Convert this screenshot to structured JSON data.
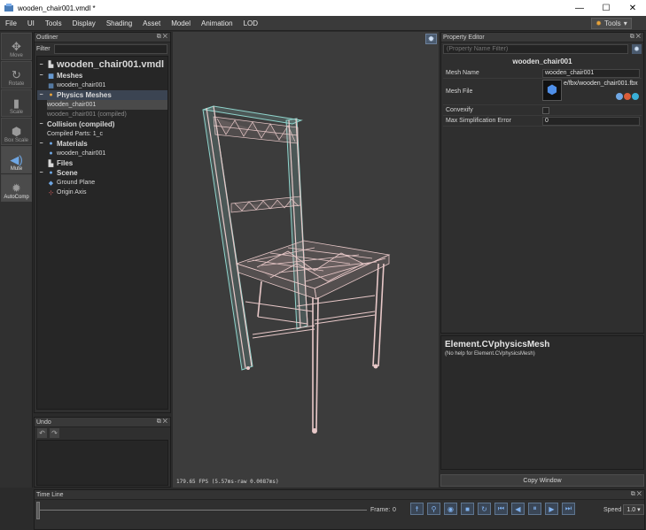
{
  "window": {
    "title": "wooden_chair001.vmdl *",
    "minimize": "—",
    "maximize": "☐",
    "close": "✕"
  },
  "menu": {
    "items": [
      "File",
      "UI",
      "Tools",
      "Display",
      "Shading",
      "Asset",
      "Model",
      "Animation",
      "LOD"
    ],
    "tools_button": "Tools"
  },
  "left_tools": [
    {
      "label": "Move",
      "icon": "move-icon"
    },
    {
      "label": "Rotate",
      "icon": "rotate-icon"
    },
    {
      "label": "Scale",
      "icon": "scale-icon"
    },
    {
      "label": "Box Scale",
      "icon": "box-scale-icon"
    },
    {
      "label": "Mute",
      "icon": "mute-icon"
    },
    {
      "label": "AutoComp",
      "icon": "autocomp-icon"
    }
  ],
  "outliner": {
    "title": "Outliner",
    "filter_label": "Filter",
    "filter_value": "",
    "root": "wooden_chair001.vmdl",
    "meshes_header": "Meshes",
    "mesh_item": "wooden_chair001",
    "physics_header": "Physics Meshes",
    "physics_item": "wooden_chair001",
    "physics_compiled": "wooden_chair001 (compiled)",
    "collision_header": "Collision (compiled)",
    "compiled_parts": "Compiled Parts: 1_c",
    "materials_header": "Materials",
    "material_item": "wooden_chair001",
    "files_header": "Files",
    "scene_header": "Scene",
    "ground_plane": "Ground Plane",
    "origin_axis": "Origin Axis"
  },
  "undo": {
    "title": "Undo"
  },
  "viewport": {
    "fps_readout": "179.65 FPS (5.57ms-raw 0.0087ms)"
  },
  "properties": {
    "title": "Property Editor",
    "filter_placeholder": "(Property Name Filter)",
    "object_name": "wooden_chair001",
    "rows": {
      "mesh_name_label": "Mesh Name",
      "mesh_name_value": "wooden_chair001",
      "mesh_file_label": "Mesh File",
      "mesh_file_value": "e/fbx/wooden_chair001.fbx",
      "mesh_file_thumb": "FBX",
      "convexify_label": "Convexify",
      "convexify_checked": false,
      "max_simplification_label": "Max Simplification Error",
      "max_simplification_value": "0"
    }
  },
  "help": {
    "title": "Element.CVphysicsMesh",
    "text": "(No help for Element.CVphysicsMesh)",
    "copy_button": "Copy Window"
  },
  "timeline": {
    "title": "Time Line",
    "frame_label": "Frame:",
    "frame_value": "0",
    "speed_label": "Speed",
    "speed_value": "1.0"
  },
  "colors": {
    "accent_blue": "#6fa7e4",
    "gear_orange": "#e8a33a",
    "mesh_wire": "#e8c8c8",
    "collision_wire": "#8fd4cc"
  }
}
